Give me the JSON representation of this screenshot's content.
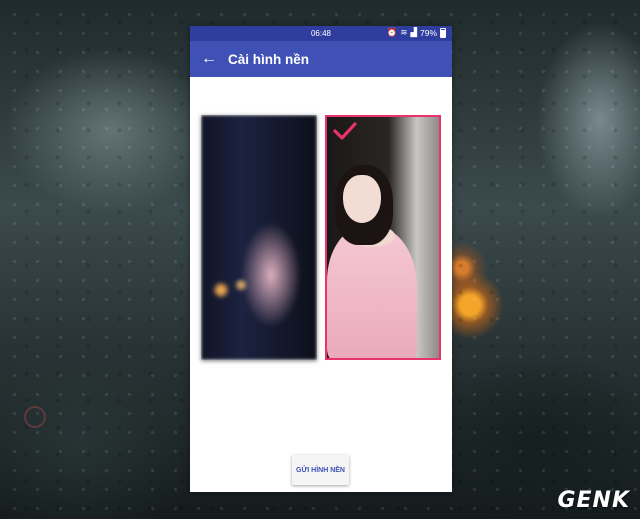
{
  "status_bar": {
    "time": "06:48",
    "battery": "79%",
    "icons": [
      "alarm-icon",
      "wifi-icon",
      "signal-icon",
      "battery-icon"
    ]
  },
  "app_bar": {
    "title": "Cài hình nền",
    "back_icon": "arrow-back-icon",
    "color": "#3f51b5",
    "status_color": "#2f3e9e"
  },
  "wallpapers": [
    {
      "selected": false
    },
    {
      "selected": true,
      "indicator": "check-icon",
      "accent": "#e8346b"
    }
  ],
  "actions": {
    "send_label": "GỬI HÌNH NỀN"
  },
  "watermark": {
    "logo": "GENK"
  }
}
